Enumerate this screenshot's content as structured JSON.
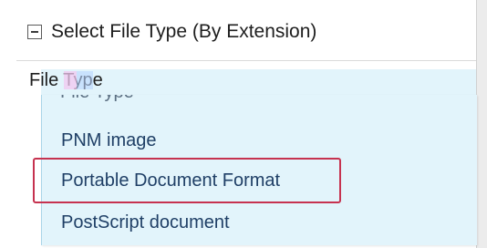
{
  "group": {
    "title": "Select File Type (By Extension)",
    "collapse_icon": "minus-box-icon"
  },
  "field": {
    "label": "File Type"
  },
  "dropdown": {
    "partial_item": "File Type",
    "items": [
      {
        "label": "PNM image"
      },
      {
        "label": "Portable Document Format",
        "highlighted": true
      },
      {
        "label": "PostScript document"
      }
    ]
  },
  "colors": {
    "dropdown_bg": "#e2f4fb",
    "highlight_border": "#c6324f",
    "item_text": "#1f3f66"
  }
}
